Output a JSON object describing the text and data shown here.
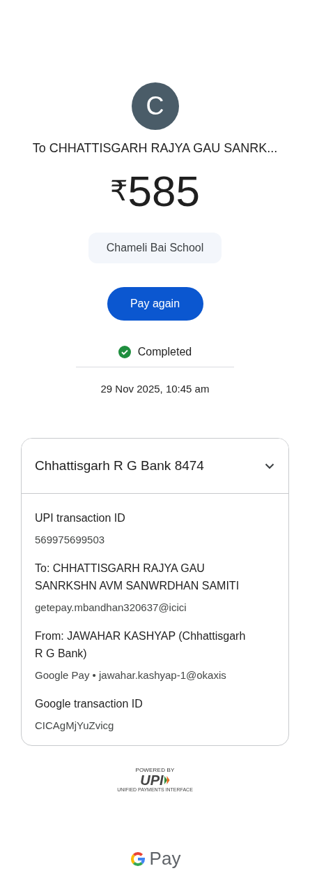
{
  "avatar": {
    "initial": "C"
  },
  "payee_title": "To CHHATTISGARH RAJYA GAU SANRK...",
  "amount": {
    "currency": "₹",
    "value": "585"
  },
  "note": "Chameli Bai School",
  "pay_again_button": "Pay again",
  "status": {
    "kind": "completed",
    "label": "Completed"
  },
  "date": "29 Nov 2025, 10:45 am",
  "details_card": {
    "account": "Chhattisgarh R G Bank 8474",
    "expanded": true,
    "fields": [
      {
        "label": "UPI transaction ID",
        "value": "569975699503"
      },
      {
        "label": "To: CHHATTISGARH RAJYA GAU SANRKSHN AVM SANWRDHAN SAMITI",
        "value": "getepay.mbandhan320637@icici"
      },
      {
        "label": "From: JAWAHAR KASHYAP (Chhattisgarh R G Bank)",
        "value": "Google Pay • jawahar.kashyap-1@okaxis"
      },
      {
        "label": "Google transaction ID",
        "value": "CICAgMjYuZvicg"
      }
    ]
  },
  "upi_badge": {
    "caption": "POWERED BY",
    "logo": "UPI",
    "tagline": "UNIFIED PAYMENTS INTERFACE"
  },
  "brand": {
    "name": "Pay"
  }
}
